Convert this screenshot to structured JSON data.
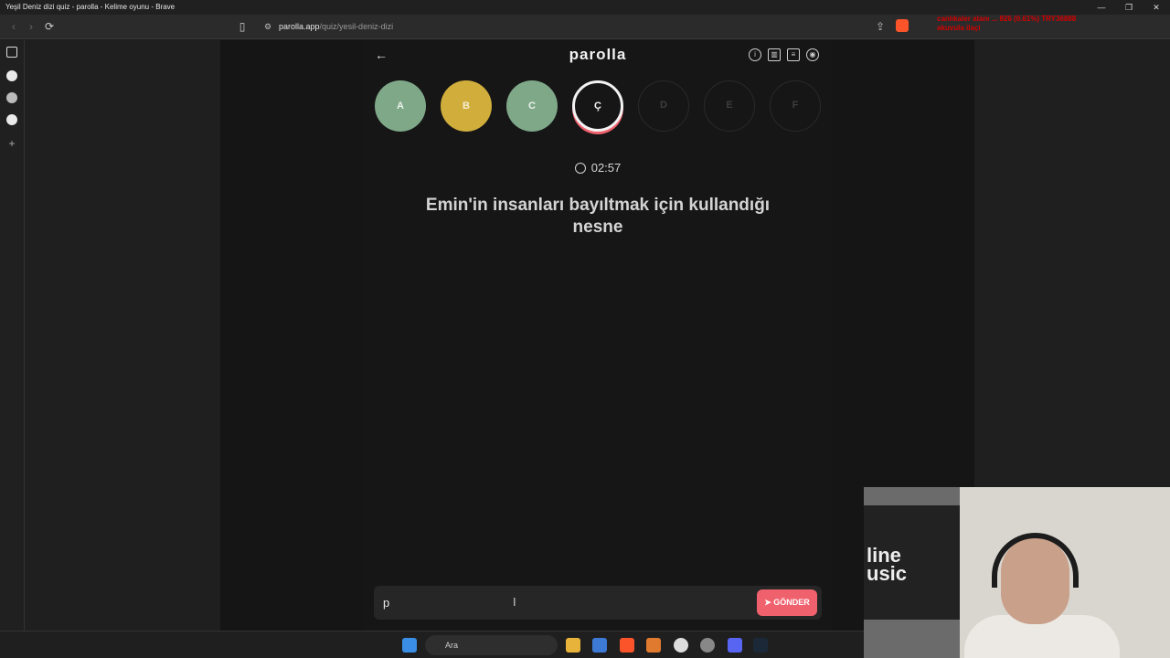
{
  "window": {
    "title": "Yeşil Deniz dizi quiz - parolla - Kelime oyunu - Brave",
    "controls": [
      "—",
      "❐",
      "✕"
    ]
  },
  "browser": {
    "url_domain": "parolla.app",
    "url_path": "/quiz/yesil-deniz-dizi",
    "ticker_line1": "canlıkaler alanı     ... 826 (0.61%)     TRY36888",
    "ticker_line2": "akuvula ilaçi"
  },
  "app": {
    "logo": "parolla",
    "letters": [
      {
        "label": "A",
        "state": "correct",
        "bg": "#7fa889",
        "fg": "#e9f2ea"
      },
      {
        "label": "B",
        "state": "passed",
        "bg": "#d1ae3c",
        "fg": "#f5ecd0"
      },
      {
        "label": "C",
        "state": "correct",
        "bg": "#7fa889",
        "fg": "#e9f2ea"
      },
      {
        "label": "Ç",
        "state": "active",
        "bg": "#161616",
        "fg": "#f2f2f2"
      },
      {
        "label": "D",
        "state": "pending",
        "bg": "#161616",
        "fg": "#3d3d3d"
      },
      {
        "label": "E",
        "state": "pending",
        "bg": "#161616",
        "fg": "#3d3d3d"
      },
      {
        "label": "F",
        "state": "pending",
        "bg": "#161616",
        "fg": "#3d3d3d"
      }
    ],
    "timer": "02:57",
    "question": "Emin'in insanları bayıltmak için kullandığı nesne",
    "answer_value": "p",
    "send_label": "GÖNDER",
    "accent": "#f0616e"
  },
  "taskbar": {
    "search_label": "Ara"
  },
  "webcam": {
    "sign_text": "line\nusic"
  }
}
